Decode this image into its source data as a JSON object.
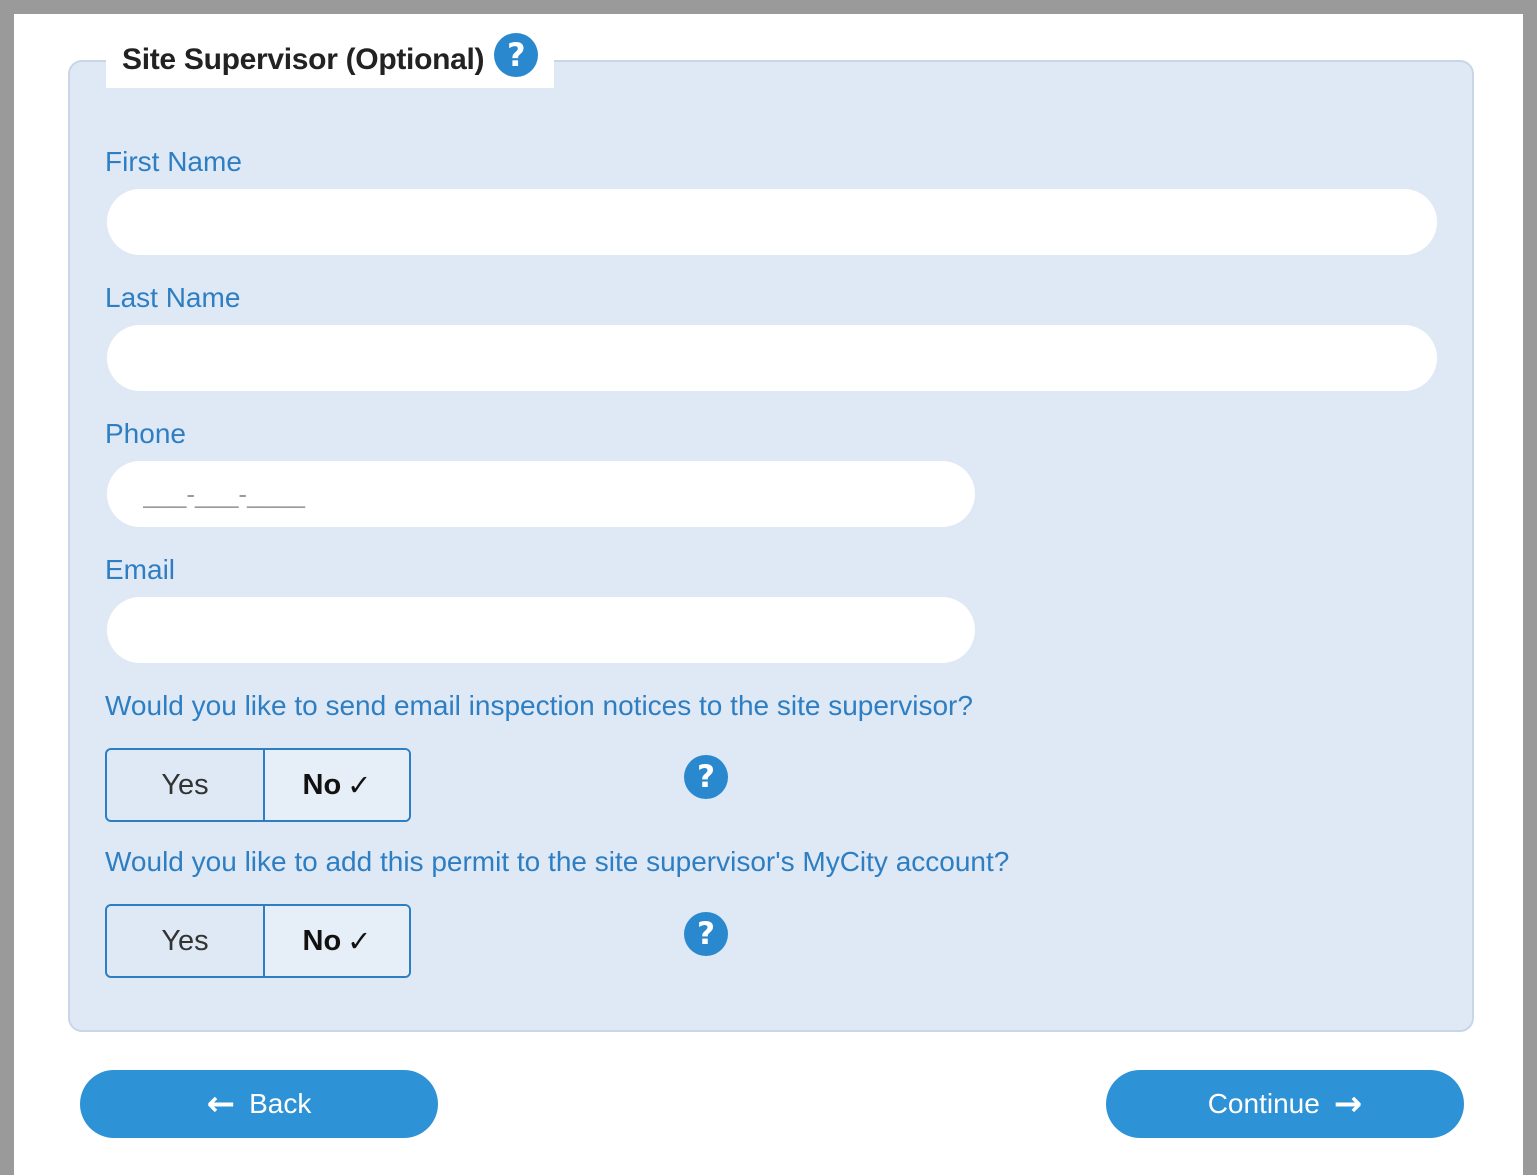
{
  "section": {
    "title": "Site Supervisor (Optional)",
    "help_glyph": "?"
  },
  "fields": {
    "first_name": {
      "label": "First Name",
      "value": ""
    },
    "last_name": {
      "label": "Last Name",
      "value": ""
    },
    "phone": {
      "label": "Phone",
      "placeholder": "___-___-____",
      "value": ""
    },
    "email": {
      "label": "Email",
      "value": ""
    }
  },
  "questions": [
    {
      "text": "Would you like to send email inspection notices to the site supervisor?",
      "yes_label": "Yes",
      "no_label": "No",
      "check": "✓",
      "selected": "No"
    },
    {
      "text": "Would you like to add this permit to the site supervisor's MyCity account?",
      "yes_label": "Yes",
      "no_label": "No",
      "check": "✓",
      "selected": "No"
    }
  ],
  "navigation": {
    "back_label": "Back",
    "back_icon": "arrow-left-icon",
    "continue_label": "Continue",
    "continue_icon": "arrow-right-icon"
  },
  "colors": {
    "accent": "#2d92d6",
    "label": "#2d7ec2",
    "panel": "#dfe9f5"
  }
}
